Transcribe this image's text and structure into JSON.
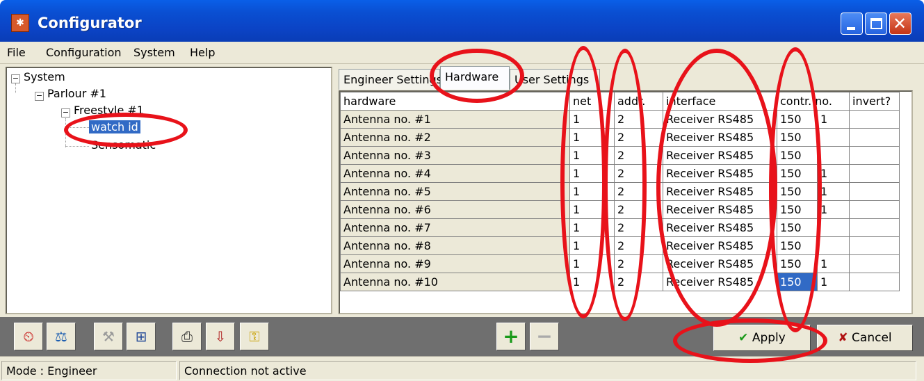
{
  "window": {
    "title": "Configurator"
  },
  "menu": [
    "File",
    "Configuration",
    "System",
    "Help"
  ],
  "tree": {
    "system": "System",
    "parlour": "Parlour #1",
    "freestyle": "Freestyle #1",
    "watch": "watch id",
    "sensomatic": "Sensomatic"
  },
  "tabs": [
    "Engineer Settings",
    "Hardware",
    "User Settings"
  ],
  "grid": {
    "headers": [
      "hardware",
      "net",
      "addr.",
      "interface",
      "contr. no.",
      "invert?"
    ],
    "rows": [
      [
        "Antenna no. #1",
        "1",
        "2",
        "Receiver RS485",
        "150",
        "1",
        ""
      ],
      [
        "Antenna no. #2",
        "1",
        "2",
        "Receiver RS485",
        "150",
        "",
        ""
      ],
      [
        "Antenna no. #3",
        "1",
        "2",
        "Receiver RS485",
        "150",
        "",
        ""
      ],
      [
        "Antenna no. #4",
        "1",
        "2",
        "Receiver RS485",
        "150",
        "1",
        ""
      ],
      [
        "Antenna no. #5",
        "1",
        "2",
        "Receiver RS485",
        "150",
        "1",
        ""
      ],
      [
        "Antenna no. #6",
        "1",
        "2",
        "Receiver RS485",
        "150",
        "1",
        ""
      ],
      [
        "Antenna no. #7",
        "1",
        "2",
        "Receiver RS485",
        "150",
        "",
        ""
      ],
      [
        "Antenna no. #8",
        "1",
        "2",
        "Receiver RS485",
        "150",
        "",
        ""
      ],
      [
        "Antenna no. #9",
        "1",
        "2",
        "Receiver RS485",
        "150",
        "1",
        ""
      ],
      [
        "Antenna no. #10",
        "1",
        "2",
        "Receiver RS485",
        "150",
        "1",
        ""
      ]
    ]
  },
  "buttons": {
    "apply": "Apply",
    "cancel": "Cancel"
  },
  "status": {
    "mode": "Mode : Engineer",
    "connection": "Connection not active"
  },
  "colors": {
    "highlight": "#e8121a",
    "selection": "#316ac5"
  }
}
